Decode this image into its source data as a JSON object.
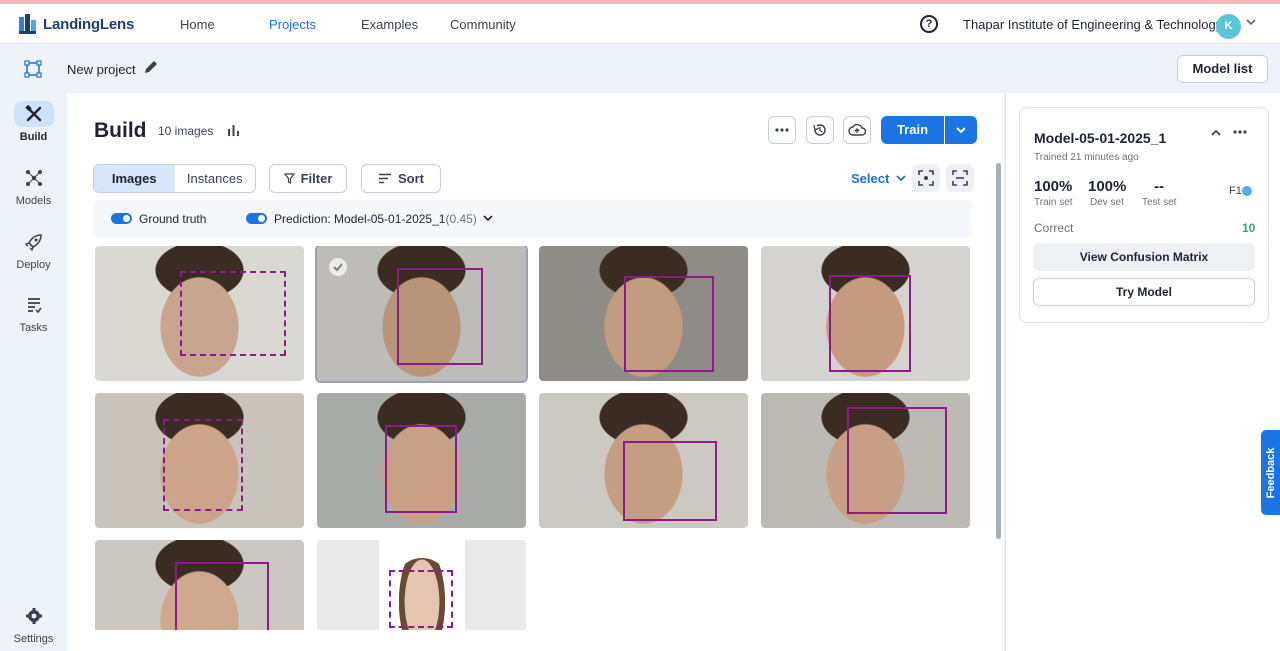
{
  "app": {
    "brand": "LandingLens"
  },
  "nav": {
    "items": [
      "Home",
      "Projects",
      "Examples",
      "Community"
    ],
    "active": "Projects"
  },
  "header": {
    "organization": "Thapar Institute of Engineering & Technology",
    "avatar_initial": "K"
  },
  "project": {
    "name": "New project",
    "model_list_label": "Model list"
  },
  "sidebar": {
    "items": [
      {
        "label": "Build",
        "icon": "hammer-wrench-icon",
        "active": true
      },
      {
        "label": "Models",
        "icon": "network-icon"
      },
      {
        "label": "Deploy",
        "icon": "rocket-icon"
      },
      {
        "label": "Tasks",
        "icon": "checklist-icon"
      }
    ],
    "settings_label": "Settings"
  },
  "build": {
    "title": "Build",
    "image_count": "10 images",
    "train_label": "Train",
    "tabs": [
      {
        "label": "Images",
        "active": true
      },
      {
        "label": "Instances"
      }
    ],
    "filter_label": "Filter",
    "sort_label": "Sort",
    "select_label": "Select",
    "ground_truth_label": "Ground truth",
    "prediction_label": "Prediction: Model-05-01-2025_1",
    "prediction_threshold": "(0.45)"
  },
  "images": [
    {
      "id": "img-1",
      "tone": [
        "#d9d8d3",
        "#c8a58f"
      ],
      "selected": false
    },
    {
      "id": "img-2",
      "tone": [
        "#bdbcb8",
        "#b89479"
      ],
      "selected": true
    },
    {
      "id": "img-3",
      "tone": [
        "#8f8c88",
        "#c29b80"
      ],
      "selected": false
    },
    {
      "id": "img-4",
      "tone": [
        "#d5d3cf",
        "#c59a7e"
      ],
      "selected": false
    },
    {
      "id": "img-5",
      "tone": [
        "#c9c4bb",
        "#cda489"
      ],
      "selected": false
    },
    {
      "id": "img-6",
      "tone": [
        "#a9aba9",
        "#c9a085"
      ],
      "selected": false
    },
    {
      "id": "img-7",
      "tone": [
        "#ccc9c3",
        "#c59d82"
      ],
      "selected": false
    },
    {
      "id": "img-8",
      "tone": [
        "#bdbab6",
        "#c89f86"
      ],
      "selected": false
    },
    {
      "id": "img-9",
      "tone": [
        "#cbc8c2",
        "#cfa78c"
      ],
      "selected": false
    },
    {
      "id": "img-10",
      "tone": [
        "#e8e8e8",
        "#e4c6b0"
      ],
      "selected": false
    }
  ],
  "model": {
    "name": "Model-05-01-2025_1",
    "trained": "Trained 21 minutes ago",
    "metrics": [
      {
        "value": "100%",
        "label": "Train set"
      },
      {
        "value": "100%",
        "label": "Dev set"
      },
      {
        "value": "--",
        "label": "Test set"
      }
    ],
    "metric_type": "F1",
    "correct_label": "Correct",
    "correct_value": "10",
    "confusion_label": "View Confusion Matrix",
    "try_label": "Try Model"
  },
  "feedback_label": "Feedback",
  "colors": {
    "accent": "#1b74e4",
    "bbox": "#8e1b88",
    "success": "#2bae6a"
  }
}
